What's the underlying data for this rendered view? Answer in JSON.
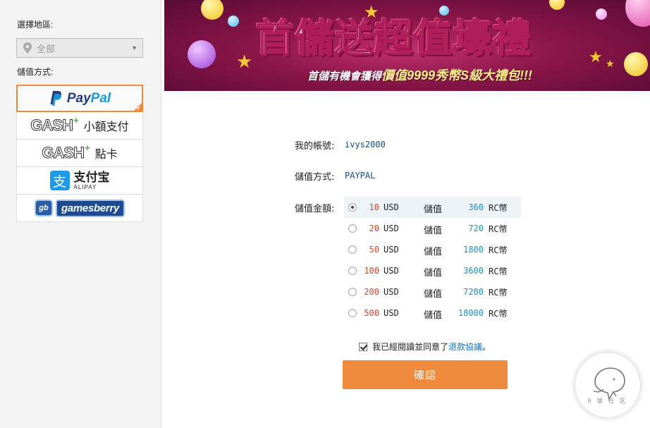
{
  "sidebar": {
    "region_label": "選擇地區:",
    "region_value": "全部",
    "method_label": "儲值方式:",
    "methods": [
      {
        "key": "paypal",
        "text_a": "Pay",
        "text_b": "Pal",
        "selected": true
      },
      {
        "key": "cash-small",
        "logo": "GASH",
        "sub": "小額支付"
      },
      {
        "key": "cash-point",
        "logo": "GASH",
        "sub": "點卡"
      },
      {
        "key": "alipay",
        "cn": "支付宝",
        "en": "ALIPAY"
      },
      {
        "key": "gamesberry",
        "badge": "gb",
        "word": "gamesberry"
      }
    ]
  },
  "banner": {
    "title_a": "首儲送",
    "title_b": "超值",
    "title_c": "壕禮",
    "subtitle_a": "首儲有機會獲得",
    "subtitle_b": "價值9999秀幣S級大禮包!!!"
  },
  "form": {
    "account_label": "我的帳號:",
    "account_value": "ivys2000",
    "method_label": "儲值方式:",
    "method_value": "PAYPAL",
    "amount_label": "儲值金額:",
    "currency": "USD",
    "verb": "儲值",
    "unit": "RC幣",
    "options": [
      {
        "amount": "10",
        "rc": "360",
        "checked": true
      },
      {
        "amount": "20",
        "rc": "720",
        "checked": false
      },
      {
        "amount": "50",
        "rc": "1800",
        "checked": false
      },
      {
        "amount": "100",
        "rc": "3600",
        "checked": false
      },
      {
        "amount": "200",
        "rc": "7200",
        "checked": false
      },
      {
        "amount": "500",
        "rc": "18000",
        "checked": false
      }
    ],
    "agree_text": "我已經閱讀並同意了",
    "agree_link": "退款協議",
    "agree_end": "。",
    "confirm_label": "確認"
  },
  "watermark": {
    "text": "6 號 社 区"
  },
  "colors": {
    "accent": "#ef8a3d",
    "amount": "#e0402a",
    "rc": "#1c8fc7",
    "link": "#1a6fc1"
  }
}
